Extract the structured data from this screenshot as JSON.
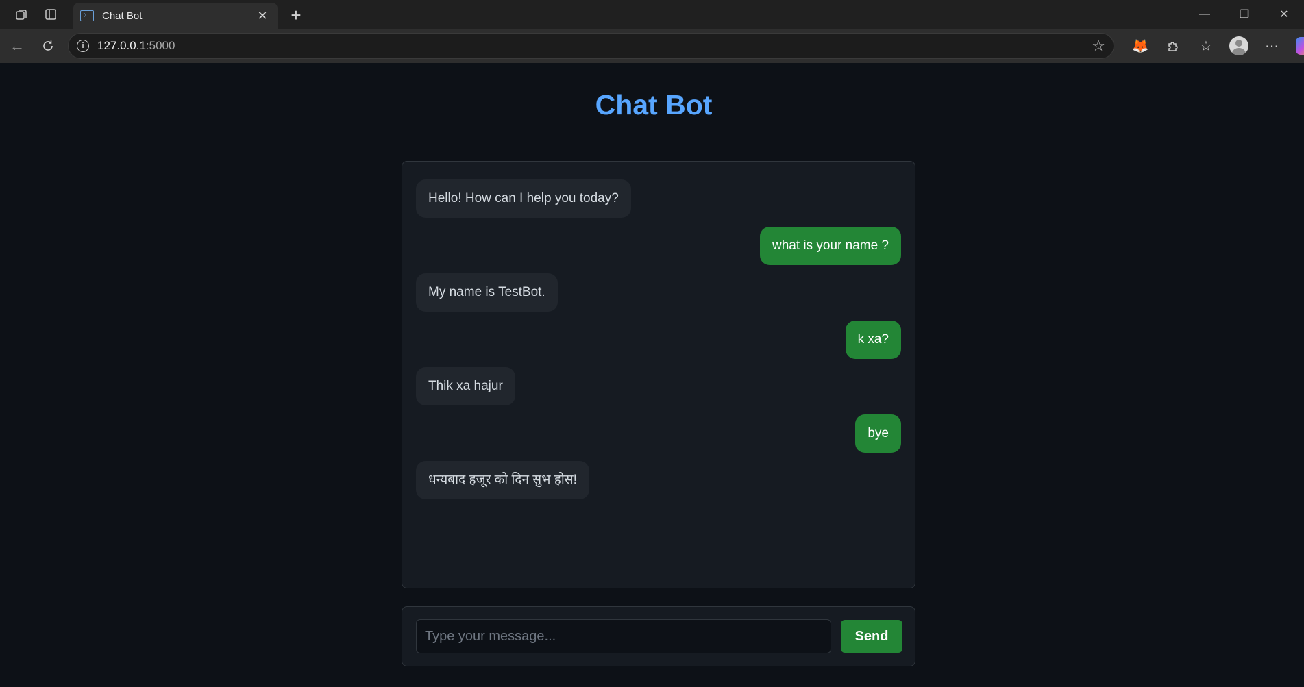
{
  "browser": {
    "tab_title": "Chat Bot",
    "url_host": "127.0.0.1",
    "url_port": ":5000"
  },
  "app": {
    "title": "Chat Bot"
  },
  "messages": [
    {
      "role": "bot",
      "text": "Hello! How can I help you today?"
    },
    {
      "role": "user",
      "text": "what is your name ?"
    },
    {
      "role": "bot",
      "text": "My name is TestBot."
    },
    {
      "role": "user",
      "text": "k xa?"
    },
    {
      "role": "bot",
      "text": "Thik xa hajur"
    },
    {
      "role": "user",
      "text": "bye"
    },
    {
      "role": "bot",
      "text": "धन्यबाद हजूर को दिन सुभ होस!"
    }
  ],
  "input": {
    "value": "",
    "placeholder": "Type your message...",
    "send_label": "Send"
  },
  "colors": {
    "accent": "#58a6ff",
    "user_bubble": "#238636",
    "bot_bubble": "#21262d",
    "background": "#0d1117"
  }
}
